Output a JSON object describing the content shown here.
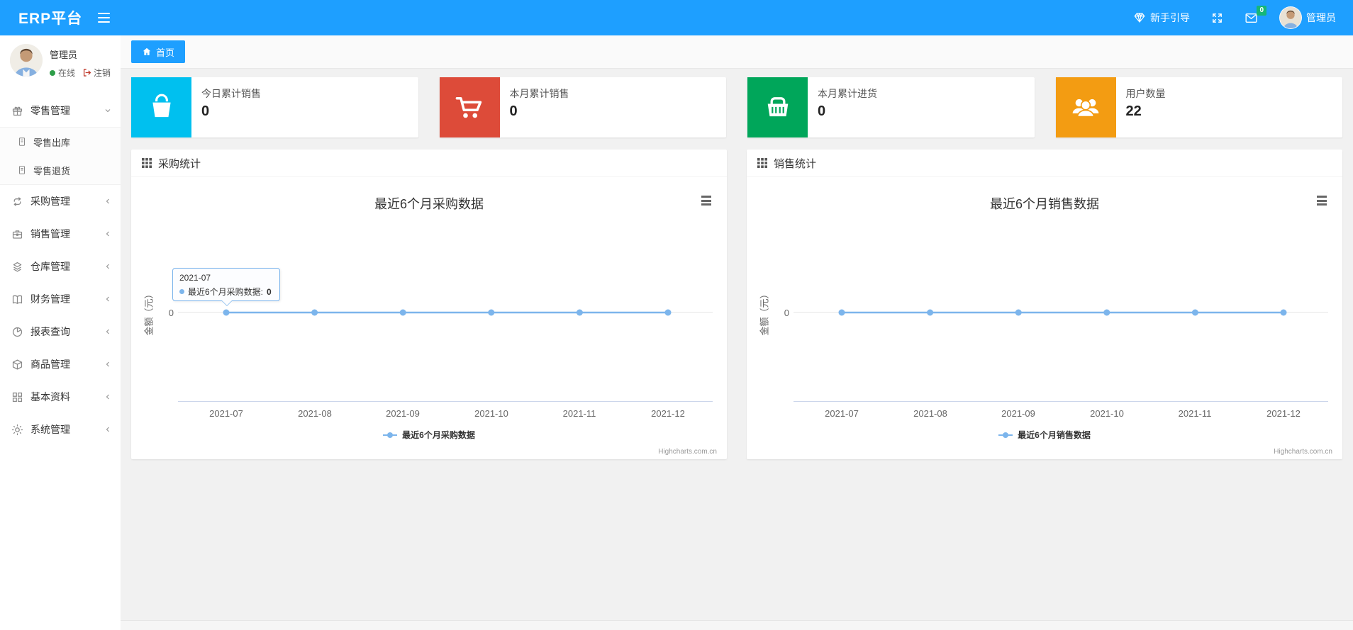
{
  "colors": {
    "navbar_blue": "#1E9FFF",
    "badge_green": "#16b777",
    "chart_line": "#7cb5ec",
    "card_aqua": "#00c0ef",
    "card_red": "#dd4b39",
    "card_green": "#00a65a",
    "card_orange": "#f39c12"
  },
  "navbar": {
    "brand": "ERP平台",
    "guide_label": "新手引导",
    "message_badge": "0",
    "username": "管理员"
  },
  "sidebar": {
    "user": {
      "name": "管理员",
      "online": "在线",
      "logout": "注销"
    },
    "items": [
      {
        "label": "零售管理",
        "icon": "gift-icon",
        "state": "expanded"
      },
      {
        "label": "采购管理",
        "icon": "loop-icon",
        "state": "collapsed"
      },
      {
        "label": "销售管理",
        "icon": "briefcase-icon",
        "state": "collapsed"
      },
      {
        "label": "仓库管理",
        "icon": "layers-icon",
        "state": "collapsed"
      },
      {
        "label": "财务管理",
        "icon": "book-icon",
        "state": "collapsed"
      },
      {
        "label": "报表查询",
        "icon": "pie-chart-icon",
        "state": "collapsed"
      },
      {
        "label": "商品管理",
        "icon": "cube-icon",
        "state": "collapsed"
      },
      {
        "label": "基本资料",
        "icon": "grid-icon",
        "state": "collapsed"
      },
      {
        "label": "系统管理",
        "icon": "gear-icon",
        "state": "collapsed"
      }
    ],
    "subitems": [
      {
        "label": "零售出库",
        "icon": "document-icon"
      },
      {
        "label": "零售退货",
        "icon": "document-icon"
      }
    ]
  },
  "tabbar": {
    "home": "首页"
  },
  "cards": [
    {
      "label": "今日累计销售",
      "value": "0",
      "icon": "shopping-bag-icon",
      "color": "#00c0ef"
    },
    {
      "label": "本月累计销售",
      "value": "0",
      "icon": "shopping-cart-icon",
      "color": "#dd4b39"
    },
    {
      "label": "本月累计进货",
      "value": "0",
      "icon": "shopping-basket-icon",
      "color": "#00a65a"
    },
    {
      "label": "用户数量",
      "value": "22",
      "icon": "users-icon",
      "color": "#f39c12"
    }
  ],
  "panels": [
    {
      "title": "采购统计"
    },
    {
      "title": "销售统计"
    }
  ],
  "chart_data": [
    {
      "type": "line",
      "title": "最近6个月采购数据",
      "categories": [
        "2021-07",
        "2021-08",
        "2021-09",
        "2021-10",
        "2021-11",
        "2021-12"
      ],
      "series": [
        {
          "name": "最近6个月采购数据",
          "values": [
            0,
            0,
            0,
            0,
            0,
            0
          ],
          "color": "#7cb5ec"
        }
      ],
      "ylabel": "金额（元）",
      "ytick": "0",
      "ylim": [
        0,
        0
      ],
      "grid": true,
      "legend_position": "bottom-center",
      "credits": "Highcharts.com.cn",
      "tooltip": {
        "header": "2021-07",
        "label": "最近6个月采购数据:",
        "value": "0"
      }
    },
    {
      "type": "line",
      "title": "最近6个月销售数据",
      "categories": [
        "2021-07",
        "2021-08",
        "2021-09",
        "2021-10",
        "2021-11",
        "2021-12"
      ],
      "series": [
        {
          "name": "最近6个月销售数据",
          "values": [
            0,
            0,
            0,
            0,
            0,
            0
          ],
          "color": "#7cb5ec"
        }
      ],
      "ylabel": "金额（元）",
      "ytick": "0",
      "ylim": [
        0,
        0
      ],
      "grid": true,
      "legend_position": "bottom-center",
      "credits": "Highcharts.com.cn"
    }
  ]
}
